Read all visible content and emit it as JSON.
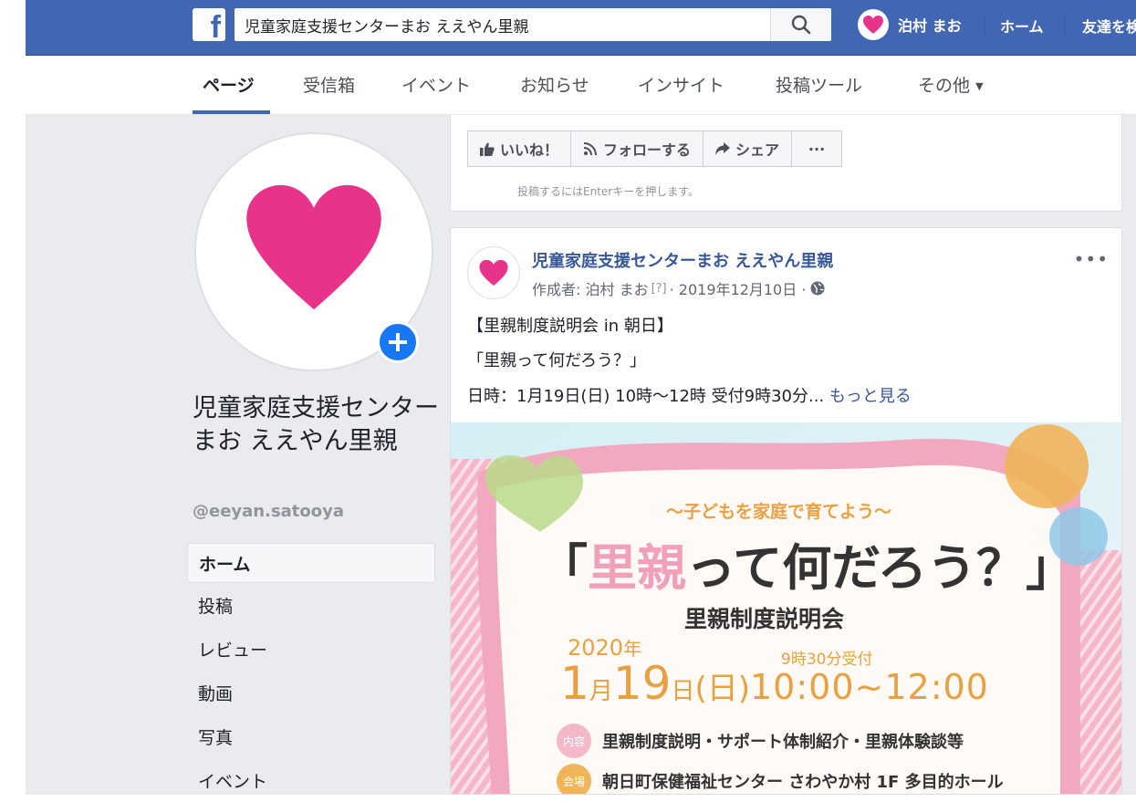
{
  "topbar": {
    "logo": "f",
    "search_value": "児童家庭支援センターまお ええやん里親",
    "user_name": "泊村 まお",
    "nav_home": "ホーム",
    "nav_friends": "友達を検"
  },
  "page_tabs": [
    "ページ",
    "受信箱",
    "イベント",
    "お知らせ",
    "インサイト",
    "投稿ツール",
    "その他"
  ],
  "page_tabs_more_arrow": "▼",
  "sidebar": {
    "page_name": "児童家庭支援センターまお ええやん里親",
    "handle": "@eeyan.satooya",
    "items": [
      "ホーム",
      "投稿",
      "レビュー",
      "動画",
      "写真",
      "イベント"
    ]
  },
  "actions": {
    "like": "いいね！",
    "follow": "フォローする",
    "share": "シェア",
    "more": "···",
    "hint": "投稿するにはEnterキーを押します。"
  },
  "post": {
    "author": "児童家庭支援センターまお ええやん里親",
    "creator_prefix": "作成者: 泊村 まお",
    "creator_q": "[?]",
    "date": "· 2019年12月10日 ·",
    "more": "•••",
    "line1": "【里親制度説明会 in 朝日】",
    "line2": "「里親って何だろう？」",
    "line3": "日時：1月19日(日) 10時～12時 受付9時30分...",
    "see_more": "もっと見る"
  },
  "flyer": {
    "subtitle": "～子どもを家庭で育てよう～",
    "title_pink": "里親",
    "title_rest": "って何だろう？",
    "bracket_open": "「",
    "bracket_close": "」",
    "event_name": "里親制度説明会",
    "year": "2020",
    "year_unit": "年",
    "reception": "9時30分受付",
    "month": "1",
    "month_unit": "月",
    "day": "19",
    "day_unit": "日",
    "weekday": "(日)",
    "time": "10:00~12:00",
    "content_tag": "内容",
    "content": "里親制度説明・サポート体制紹介・里親体験談等",
    "venue_tag": "会場",
    "venue": "朝日町保健福祉センター さわやか村 1F 多目的ホール"
  },
  "colors": {
    "brand_blue": "#4267b2",
    "heart_pink": "#e8338a",
    "link_blue": "#385898",
    "flyer_orange": "#e9a040"
  }
}
